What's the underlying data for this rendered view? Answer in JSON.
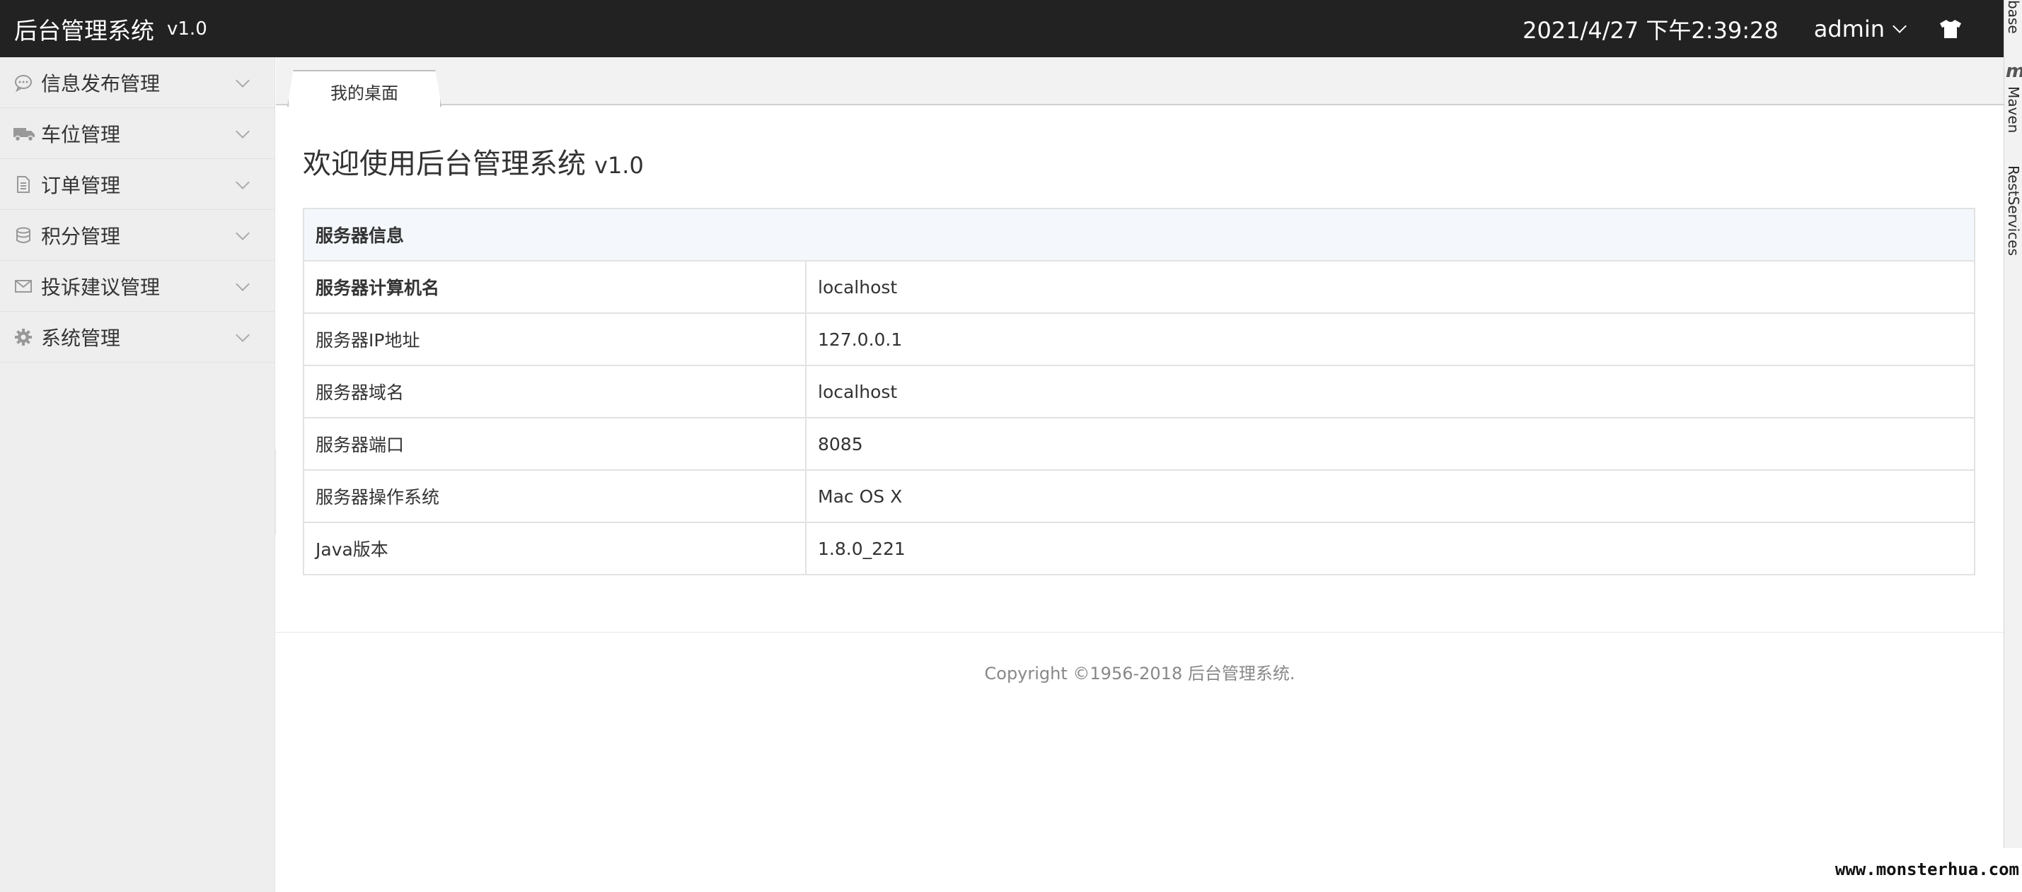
{
  "header": {
    "title": "后台管理系统",
    "version": "v1.0",
    "datetime": "2021/4/27 下午2:39:28",
    "user": "admin",
    "skin_icon": "tshirt-icon"
  },
  "ide_strip": {
    "tabs": [
      "base",
      "Maven",
      "RestServices"
    ]
  },
  "sidebar": {
    "items": [
      {
        "label": "信息发布管理",
        "icon": "comment-icon"
      },
      {
        "label": "车位管理",
        "icon": "truck-icon"
      },
      {
        "label": "订单管理",
        "icon": "document-icon"
      },
      {
        "label": "积分管理",
        "icon": "database-icon"
      },
      {
        "label": "投诉建议管理",
        "icon": "envelope-icon"
      },
      {
        "label": "系统管理",
        "icon": "gear-icon"
      }
    ]
  },
  "tabs": [
    {
      "label": "我的桌面",
      "active": true
    }
  ],
  "welcome": {
    "title": "欢迎使用后台管理系统",
    "version": "v1.0"
  },
  "server_info": {
    "header": "服务器信息",
    "rows": [
      {
        "key": "服务器计算机名",
        "value": "localhost"
      },
      {
        "key": "服务器IP地址",
        "value": "127.0.0.1"
      },
      {
        "key": "服务器域名",
        "value": "localhost"
      },
      {
        "key": "服务器端口",
        "value": "8085"
      },
      {
        "key": "服务器操作系统",
        "value": "Mac OS X"
      },
      {
        "key": "Java版本",
        "value": "1.8.0_221"
      }
    ]
  },
  "footer": {
    "copyright": "Copyright ©1956-2018 后台管理系统."
  },
  "watermark": "www.monsterhua.com",
  "colors": {
    "header_bg": "#222222",
    "sidebar_bg": "#eeeeee",
    "table_header_bg": "#f4f8fc",
    "border": "#e2e2e2"
  }
}
